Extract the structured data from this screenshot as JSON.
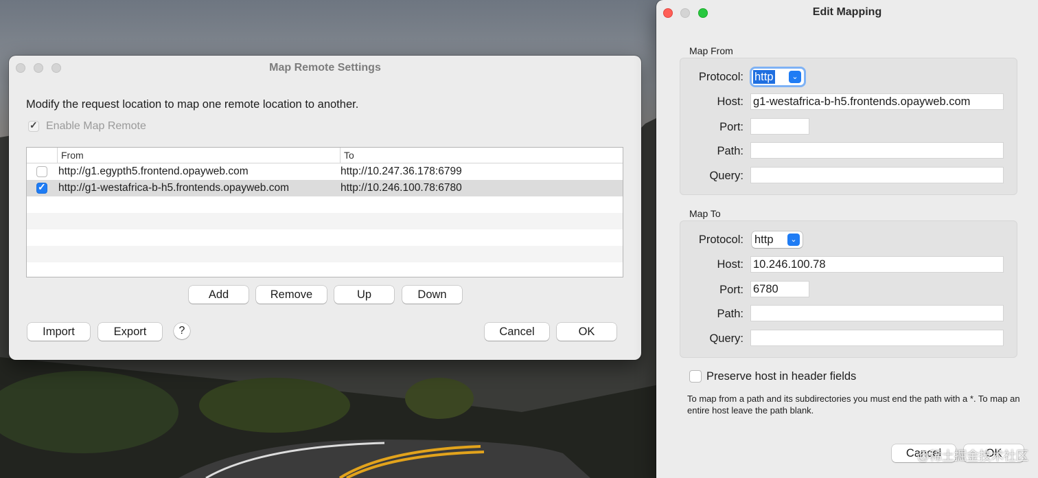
{
  "map_remote": {
    "title": "Map Remote Settings",
    "description": "Modify the request location to map one remote location to another.",
    "enable_label": "Enable Map Remote",
    "enable_checked": true,
    "columns": [
      "From",
      "To"
    ],
    "rows": [
      {
        "checked": false,
        "from": "http://g1.egypth5.frontend.opayweb.com",
        "to": "http://10.247.36.178:6799"
      },
      {
        "checked": true,
        "from": "http://g1-westafrica-b-h5.frontends.opayweb.com",
        "to": "http://10.246.100.78:6780"
      }
    ],
    "buttons": {
      "add": "Add",
      "remove": "Remove",
      "up": "Up",
      "down": "Down",
      "import": "Import",
      "export": "Export",
      "help": "?",
      "cancel": "Cancel",
      "ok": "OK"
    }
  },
  "edit_mapping": {
    "title": "Edit Mapping",
    "map_from": {
      "label": "Map From",
      "protocol_label": "Protocol:",
      "protocol": "http",
      "host_label": "Host:",
      "host": "g1-westafrica-b-h5.frontends.opayweb.com",
      "port_label": "Port:",
      "port": "",
      "path_label": "Path:",
      "path": "",
      "query_label": "Query:",
      "query": ""
    },
    "map_to": {
      "label": "Map To",
      "protocol_label": "Protocol:",
      "protocol": "http",
      "host_label": "Host:",
      "host": "10.246.100.78",
      "port_label": "Port:",
      "port": "6780",
      "path_label": "Path:",
      "path": "",
      "query_label": "Query:",
      "query": ""
    },
    "preserve_host_label": "Preserve host in header fields",
    "preserve_host_checked": false,
    "note": "To map from a path and its subdirectories you must end the path with a *. To map an entire host leave the path blank.",
    "buttons": {
      "cancel": "Cancel",
      "ok": "OK"
    }
  },
  "watermark": "@稀土掘金技术社区",
  "colors": {
    "accent": "#1f7cf4",
    "window_bg": "#ececec",
    "selection": "#dcdcdc"
  }
}
